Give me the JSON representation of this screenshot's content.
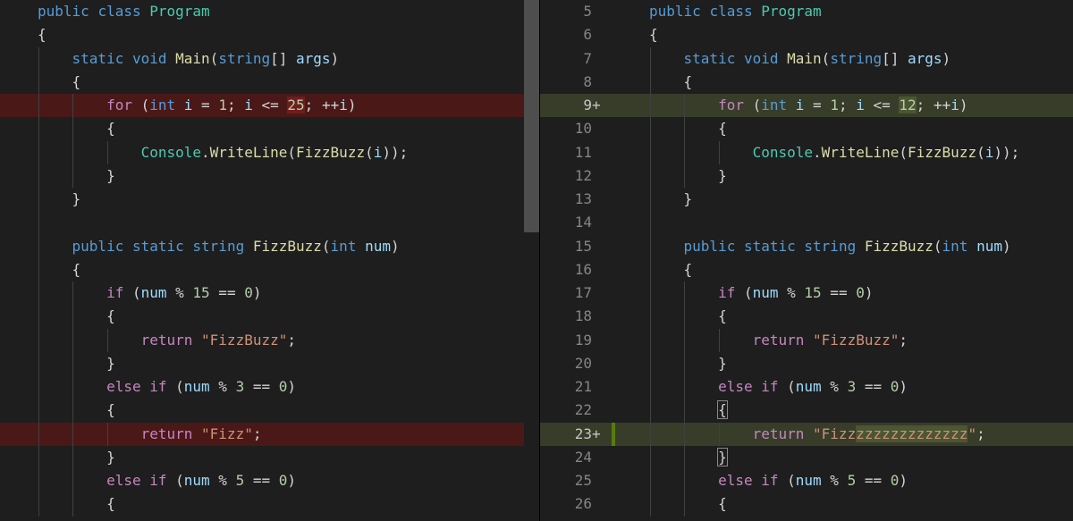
{
  "left": {
    "lines": [
      {
        "type": "ctx",
        "tokens": [
          [
            "kw",
            "public"
          ],
          [
            "pu",
            " "
          ],
          [
            "kw",
            "class"
          ],
          [
            "pu",
            " "
          ],
          [
            "ty",
            "Program"
          ]
        ]
      },
      {
        "type": "ctx",
        "tokens": [
          [
            "pu",
            "{"
          ]
        ]
      },
      {
        "type": "ctx",
        "tokens": [
          [
            "pu",
            "    "
          ],
          [
            "kw",
            "static"
          ],
          [
            "pu",
            " "
          ],
          [
            "kw",
            "void"
          ],
          [
            "pu",
            " "
          ],
          [
            "fn",
            "Main"
          ],
          [
            "pu",
            "("
          ],
          [
            "kw",
            "string"
          ],
          [
            "pu",
            "[] "
          ],
          [
            "vr",
            "args"
          ],
          [
            "pu",
            ")"
          ]
        ]
      },
      {
        "type": "ctx",
        "tokens": [
          [
            "pu",
            "    {"
          ]
        ]
      },
      {
        "type": "del",
        "tokens": [
          [
            "pu",
            "        "
          ],
          [
            "cf",
            "for"
          ],
          [
            "pu",
            " ("
          ],
          [
            "kw",
            "int"
          ],
          [
            "pu",
            " "
          ],
          [
            "vr",
            "i"
          ],
          [
            "pu",
            " = "
          ],
          [
            "nm",
            "1"
          ],
          [
            "pu",
            "; "
          ],
          [
            "vr",
            "i"
          ],
          [
            "pu",
            " <= "
          ],
          [
            "nm-del",
            "25"
          ],
          [
            "pu",
            "; ++"
          ],
          [
            "vr",
            "i"
          ],
          [
            "pu",
            ")"
          ]
        ]
      },
      {
        "type": "ctx",
        "tokens": [
          [
            "pu",
            "        {"
          ]
        ]
      },
      {
        "type": "ctx",
        "tokens": [
          [
            "pu",
            "            "
          ],
          [
            "ty",
            "Console"
          ],
          [
            "pu",
            "."
          ],
          [
            "fn",
            "WriteLine"
          ],
          [
            "pu",
            "("
          ],
          [
            "fn",
            "FizzBuzz"
          ],
          [
            "pu",
            "("
          ],
          [
            "vr",
            "i"
          ],
          [
            "pu",
            "));"
          ]
        ]
      },
      {
        "type": "ctx",
        "tokens": [
          [
            "pu",
            "        }"
          ]
        ]
      },
      {
        "type": "ctx",
        "tokens": [
          [
            "pu",
            "    }"
          ]
        ]
      },
      {
        "type": "ctx",
        "tokens": []
      },
      {
        "type": "ctx",
        "tokens": [
          [
            "pu",
            "    "
          ],
          [
            "kw",
            "public"
          ],
          [
            "pu",
            " "
          ],
          [
            "kw",
            "static"
          ],
          [
            "pu",
            " "
          ],
          [
            "kw",
            "string"
          ],
          [
            "pu",
            " "
          ],
          [
            "fn",
            "FizzBuzz"
          ],
          [
            "pu",
            "("
          ],
          [
            "kw",
            "int"
          ],
          [
            "pu",
            " "
          ],
          [
            "vr",
            "num"
          ],
          [
            "pu",
            ")"
          ]
        ]
      },
      {
        "type": "ctx",
        "tokens": [
          [
            "pu",
            "    {"
          ]
        ]
      },
      {
        "type": "ctx",
        "tokens": [
          [
            "pu",
            "        "
          ],
          [
            "cf",
            "if"
          ],
          [
            "pu",
            " ("
          ],
          [
            "vr",
            "num"
          ],
          [
            "pu",
            " % "
          ],
          [
            "nm",
            "15"
          ],
          [
            "pu",
            " == "
          ],
          [
            "nm",
            "0"
          ],
          [
            "pu",
            ")"
          ]
        ]
      },
      {
        "type": "ctx",
        "tokens": [
          [
            "pu",
            "        {"
          ]
        ]
      },
      {
        "type": "ctx",
        "tokens": [
          [
            "pu",
            "            "
          ],
          [
            "cf",
            "return"
          ],
          [
            "pu",
            " "
          ],
          [
            "st",
            "\"FizzBuzz\""
          ],
          [
            "pu",
            ";"
          ]
        ]
      },
      {
        "type": "ctx",
        "tokens": [
          [
            "pu",
            "        }"
          ]
        ]
      },
      {
        "type": "ctx",
        "tokens": [
          [
            "pu",
            "        "
          ],
          [
            "cf",
            "else"
          ],
          [
            "pu",
            " "
          ],
          [
            "cf",
            "if"
          ],
          [
            "pu",
            " ("
          ],
          [
            "vr",
            "num"
          ],
          [
            "pu",
            " % "
          ],
          [
            "nm",
            "3"
          ],
          [
            "pu",
            " == "
          ],
          [
            "nm",
            "0"
          ],
          [
            "pu",
            ")"
          ]
        ]
      },
      {
        "type": "ctx",
        "tokens": [
          [
            "pu",
            "        {"
          ]
        ]
      },
      {
        "type": "del",
        "tokens": [
          [
            "pu",
            "            "
          ],
          [
            "cf",
            "return"
          ],
          [
            "pu",
            " "
          ],
          [
            "st",
            "\"Fizz\""
          ],
          [
            "pu",
            ";"
          ]
        ]
      },
      {
        "type": "ctx",
        "tokens": [
          [
            "pu",
            "        }"
          ]
        ]
      },
      {
        "type": "ctx",
        "tokens": [
          [
            "pu",
            "        "
          ],
          [
            "cf",
            "else"
          ],
          [
            "pu",
            " "
          ],
          [
            "cf",
            "if"
          ],
          [
            "pu",
            " ("
          ],
          [
            "vr",
            "num"
          ],
          [
            "pu",
            " % "
          ],
          [
            "nm",
            "5"
          ],
          [
            "pu",
            " == "
          ],
          [
            "nm",
            "0"
          ],
          [
            "pu",
            ")"
          ]
        ]
      },
      {
        "type": "ctx",
        "tokens": [
          [
            "pu",
            "        {"
          ]
        ]
      }
    ]
  },
  "right": {
    "lines": [
      {
        "n": "5",
        "type": "ctx",
        "tokens": [
          [
            "kw",
            "public"
          ],
          [
            "pu",
            " "
          ],
          [
            "kw",
            "class"
          ],
          [
            "pu",
            " "
          ],
          [
            "ty",
            "Program"
          ]
        ]
      },
      {
        "n": "6",
        "type": "ctx",
        "tokens": [
          [
            "pu",
            "{"
          ]
        ]
      },
      {
        "n": "7",
        "type": "ctx",
        "tokens": [
          [
            "pu",
            "    "
          ],
          [
            "kw",
            "static"
          ],
          [
            "pu",
            " "
          ],
          [
            "kw",
            "void"
          ],
          [
            "pu",
            " "
          ],
          [
            "fn",
            "Main"
          ],
          [
            "pu",
            "("
          ],
          [
            "kw",
            "string"
          ],
          [
            "pu",
            "[] "
          ],
          [
            "vr",
            "args"
          ],
          [
            "pu",
            ")"
          ]
        ]
      },
      {
        "n": "8",
        "type": "ctx",
        "tokens": [
          [
            "pu",
            "    {"
          ]
        ]
      },
      {
        "n": "9",
        "marker": "+",
        "type": "add",
        "tokens": [
          [
            "pu",
            "        "
          ],
          [
            "cf",
            "for"
          ],
          [
            "pu",
            " ("
          ],
          [
            "kw",
            "int"
          ],
          [
            "pu",
            " "
          ],
          [
            "vr",
            "i"
          ],
          [
            "pu",
            " = "
          ],
          [
            "nm",
            "1"
          ],
          [
            "pu",
            "; "
          ],
          [
            "vr",
            "i"
          ],
          [
            "pu",
            " <= "
          ],
          [
            "nm-add",
            "12"
          ],
          [
            "pu",
            "; ++"
          ],
          [
            "vr",
            "i"
          ],
          [
            "pu",
            ")"
          ]
        ]
      },
      {
        "n": "10",
        "type": "ctx",
        "tokens": [
          [
            "pu",
            "        {"
          ]
        ]
      },
      {
        "n": "11",
        "type": "ctx",
        "tokens": [
          [
            "pu",
            "            "
          ],
          [
            "ty",
            "Console"
          ],
          [
            "pu",
            "."
          ],
          [
            "fn",
            "WriteLine"
          ],
          [
            "pu",
            "("
          ],
          [
            "fn",
            "FizzBuzz"
          ],
          [
            "pu",
            "("
          ],
          [
            "vr",
            "i"
          ],
          [
            "pu",
            "));"
          ]
        ]
      },
      {
        "n": "12",
        "type": "ctx",
        "tokens": [
          [
            "pu",
            "        }"
          ]
        ]
      },
      {
        "n": "13",
        "type": "ctx",
        "tokens": [
          [
            "pu",
            "    }"
          ]
        ]
      },
      {
        "n": "14",
        "type": "ctx",
        "tokens": []
      },
      {
        "n": "15",
        "type": "ctx",
        "tokens": [
          [
            "pu",
            "    "
          ],
          [
            "kw",
            "public"
          ],
          [
            "pu",
            " "
          ],
          [
            "kw",
            "static"
          ],
          [
            "pu",
            " "
          ],
          [
            "kw",
            "string"
          ],
          [
            "pu",
            " "
          ],
          [
            "fn",
            "FizzBuzz"
          ],
          [
            "pu",
            "("
          ],
          [
            "kw",
            "int"
          ],
          [
            "pu",
            " "
          ],
          [
            "vr",
            "num"
          ],
          [
            "pu",
            ")"
          ]
        ]
      },
      {
        "n": "16",
        "type": "ctx",
        "tokens": [
          [
            "pu",
            "    {"
          ]
        ]
      },
      {
        "n": "17",
        "type": "ctx",
        "tokens": [
          [
            "pu",
            "        "
          ],
          [
            "cf",
            "if"
          ],
          [
            "pu",
            " ("
          ],
          [
            "vr",
            "num"
          ],
          [
            "pu",
            " % "
          ],
          [
            "nm",
            "15"
          ],
          [
            "pu",
            " == "
          ],
          [
            "nm",
            "0"
          ],
          [
            "pu",
            ")"
          ]
        ]
      },
      {
        "n": "18",
        "type": "ctx",
        "tokens": [
          [
            "pu",
            "        {"
          ]
        ]
      },
      {
        "n": "19",
        "type": "ctx",
        "tokens": [
          [
            "pu",
            "            "
          ],
          [
            "cf",
            "return"
          ],
          [
            "pu",
            " "
          ],
          [
            "st",
            "\"FizzBuzz\""
          ],
          [
            "pu",
            ";"
          ]
        ]
      },
      {
        "n": "20",
        "type": "ctx",
        "tokens": [
          [
            "pu",
            "        }"
          ]
        ]
      },
      {
        "n": "21",
        "type": "ctx",
        "tokens": [
          [
            "pu",
            "        "
          ],
          [
            "cf",
            "else"
          ],
          [
            "pu",
            " "
          ],
          [
            "cf",
            "if"
          ],
          [
            "pu",
            " ("
          ],
          [
            "vr",
            "num"
          ],
          [
            "pu",
            " % "
          ],
          [
            "nm",
            "3"
          ],
          [
            "pu",
            " == "
          ],
          [
            "nm",
            "0"
          ],
          [
            "pu",
            ")"
          ]
        ]
      },
      {
        "n": "22",
        "type": "ctx",
        "tokens": [
          [
            "pu",
            "        "
          ],
          [
            "box",
            "{"
          ]
        ]
      },
      {
        "n": "23",
        "marker": "+",
        "type": "add",
        "tokens": [
          [
            "pu",
            "            "
          ],
          [
            "cf",
            "return"
          ],
          [
            "pu",
            " "
          ],
          [
            "st",
            "\"Fizz"
          ],
          [
            "st-add",
            "zzzzzzzzzzzzz"
          ],
          [
            "st",
            "\""
          ],
          [
            "pu",
            ";"
          ]
        ]
      },
      {
        "n": "24",
        "type": "ctx",
        "tokens": [
          [
            "pu",
            "        "
          ],
          [
            "box",
            "}"
          ]
        ]
      },
      {
        "n": "25",
        "type": "ctx",
        "tokens": [
          [
            "pu",
            "        "
          ],
          [
            "cf",
            "else"
          ],
          [
            "pu",
            " "
          ],
          [
            "cf",
            "if"
          ],
          [
            "pu",
            " ("
          ],
          [
            "vr",
            "num"
          ],
          [
            "pu",
            " % "
          ],
          [
            "nm",
            "5"
          ],
          [
            "pu",
            " == "
          ],
          [
            "nm",
            "0"
          ],
          [
            "pu",
            ")"
          ]
        ]
      },
      {
        "n": "26",
        "type": "ctx",
        "tokens": [
          [
            "pu",
            "        {"
          ]
        ]
      }
    ]
  },
  "colors": {
    "background": "#1e1e1e",
    "deleted_line": "#4b1818",
    "added_line": "#373d29",
    "keyword": "#569cd6",
    "control": "#c586c0",
    "type": "#4ec9b0",
    "function": "#dcdcaa",
    "variable": "#9cdcfe",
    "number": "#b5cea8",
    "string": "#ce9178"
  }
}
